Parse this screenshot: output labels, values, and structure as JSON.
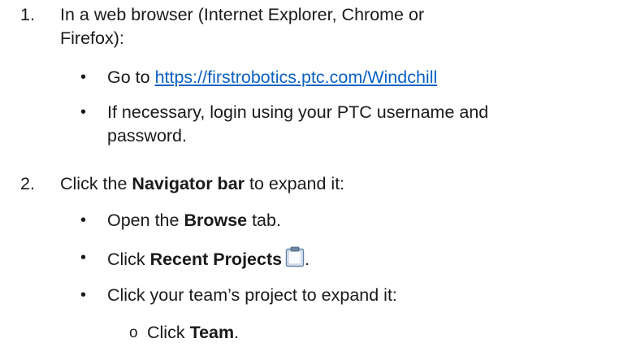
{
  "step1": {
    "number": "1.",
    "text_line1": "In a web browser (Internet Explorer, Chrome or",
    "text_line2": "Firefox):",
    "bullets": [
      {
        "prefix": "Go to ",
        "link": "https://firstrobotics.ptc.com/Windchill"
      },
      {
        "line1": "If necessary, login using your PTC username and",
        "line2": "password."
      }
    ]
  },
  "step2": {
    "number": "2.",
    "pre": "Click the ",
    "bold": "Navigator bar",
    "post": " to expand it:",
    "bullets": [
      {
        "pre": "Open the ",
        "bold": "Browse",
        "post": " tab."
      },
      {
        "pre": "Click ",
        "bold": "Recent Projects",
        "post": ".",
        "icon": "clipboard-icon"
      },
      {
        "text": "Click your team’s project to expand it:"
      }
    ],
    "subbullets": [
      {
        "marker": "o",
        "pre": "Click ",
        "bold": "Team",
        "post": "."
      }
    ]
  },
  "bullet_glyph": "•"
}
